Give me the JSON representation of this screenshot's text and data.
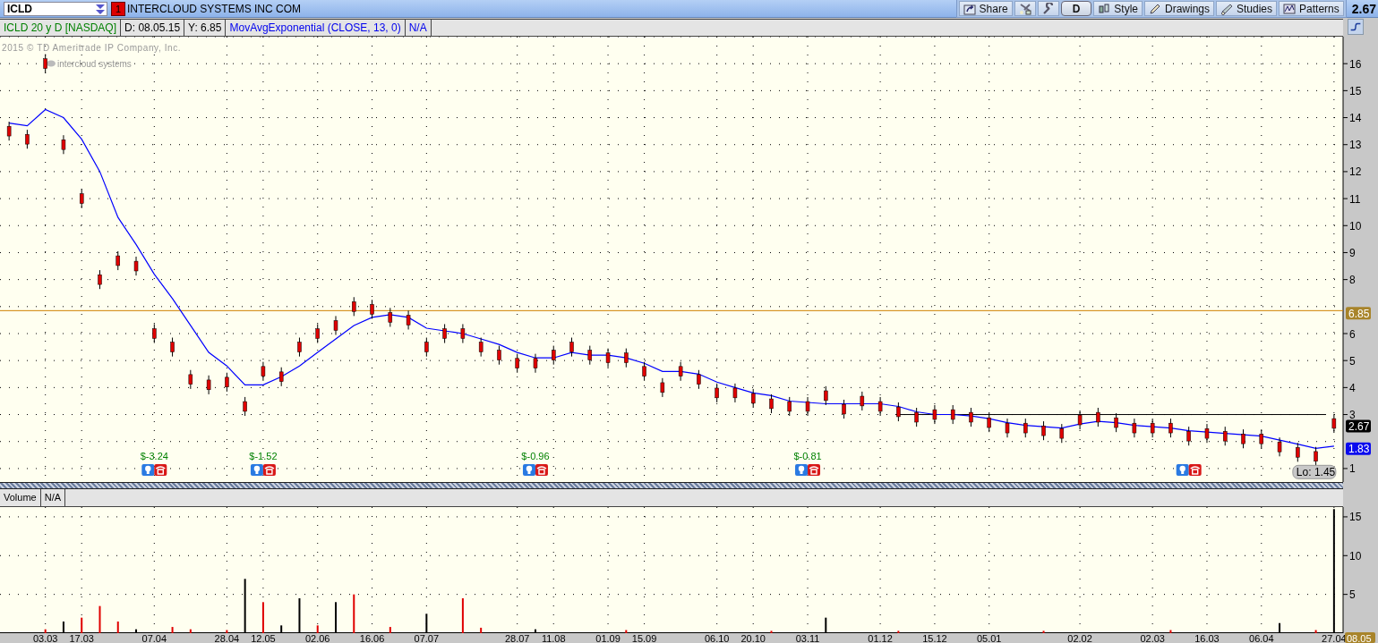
{
  "toolbar": {
    "symbol": "ICLD",
    "alert_badge": "1",
    "company": "INTERCLOUD SYSTEMS INC COM",
    "buttons": [
      {
        "label": "Share",
        "kind": "share"
      },
      {
        "kind": "tools"
      },
      {
        "kind": "wrench"
      },
      {
        "label": "D",
        "kind": "aggregation"
      },
      {
        "label": "Style",
        "kind": "style"
      },
      {
        "label": "Drawings",
        "kind": "drawings"
      },
      {
        "label": "Studies",
        "kind": "studies"
      },
      {
        "label": "Patterns",
        "kind": "patterns"
      }
    ],
    "last_price": "2.67"
  },
  "info_bar": [
    {
      "text": "ICLD 20 y D [NASDAQ]",
      "kind": "symbol"
    },
    {
      "text": "D: 08.05.15",
      "kind": "cursor"
    },
    {
      "text": "Y: 6.85",
      "kind": "cursor"
    },
    {
      "text": "MovAvgExponential (CLOSE, 13, 0)",
      "kind": "study"
    },
    {
      "text": "N/A",
      "kind": "study"
    }
  ],
  "price_pane": {
    "copyright": "2015 © TD Ameritrade IP Company, Inc.",
    "logo_text": "intercloud systems",
    "chart_data": {
      "type": "line",
      "grid": true,
      "ylim": [
        0.5,
        17
      ],
      "yticks": [
        1,
        3,
        4,
        5,
        6,
        8,
        9,
        10,
        11,
        12,
        13,
        14,
        15,
        16
      ],
      "series": [
        {
          "color": "#0000ff",
          "values": [
            13.8,
            13.7,
            14.3,
            14.0,
            13.2,
            12.0,
            10.3,
            9.3,
            8.2,
            7.3,
            6.3,
            5.3,
            4.8,
            4.1,
            4.1,
            4.4,
            4.8,
            5.3,
            5.8,
            6.3,
            6.6,
            6.7,
            6.6,
            6.2,
            6.1,
            6.0,
            5.8,
            5.6,
            5.3,
            5.1,
            5.1,
            5.3,
            5.2,
            5.2,
            5.1,
            4.9,
            4.6,
            4.6,
            4.5,
            4.2,
            4.0,
            3.8,
            3.7,
            3.5,
            3.45,
            3.4,
            3.4,
            3.4,
            3.4,
            3.3,
            3.1,
            3.0,
            3.0,
            2.95,
            2.85,
            2.7,
            2.6,
            2.55,
            2.5,
            2.65,
            2.75,
            2.7,
            2.6,
            2.55,
            2.5,
            2.4,
            2.35,
            2.3,
            2.25,
            2.2,
            2.05,
            1.9,
            1.75,
            1.83
          ]
        },
        {
          "type": "scatter",
          "color": "#e00000",
          "marker": "square",
          "values": [
            13.5,
            13.2,
            16.0,
            13.0,
            11.0,
            8.0,
            8.7,
            8.5,
            6.0,
            5.5,
            4.3,
            4.1,
            4.2,
            3.3,
            4.6,
            4.4,
            5.5,
            6.0,
            6.3,
            7.0,
            6.9,
            6.6,
            6.5,
            5.5,
            6.0,
            6.0,
            5.5,
            5.2,
            4.9,
            4.9,
            5.2,
            5.5,
            5.2,
            5.1,
            5.1,
            4.6,
            4.0,
            4.6,
            4.3,
            3.8,
            3.8,
            3.6,
            3.4,
            3.3,
            3.3,
            3.7,
            3.2,
            3.5,
            3.3,
            3.1,
            2.9,
            3.0,
            3.0,
            2.9,
            2.7,
            2.5,
            2.5,
            2.4,
            2.3,
            2.8,
            2.9,
            2.7,
            2.5,
            2.5,
            2.5,
            2.2,
            2.3,
            2.2,
            2.1,
            2.1,
            1.8,
            1.6,
            1.45,
            2.67
          ]
        }
      ],
      "ref_lines": [
        {
          "axis": "y",
          "value": 6.85,
          "color": "#d08000",
          "label": "6.85"
        },
        {
          "axis": "y",
          "value": 3,
          "color": "#000000"
        }
      ],
      "annotations": [
        "$-3.24",
        "$-1.52",
        "$-0.96",
        "$-0.81"
      ]
    },
    "price_badges": [
      {
        "text": "2.67",
        "kind": "last"
      },
      {
        "text": "1.83",
        "kind": "study"
      }
    ],
    "low_label": "Lo: 1.45"
  },
  "volume_pane": {
    "labels": [
      "Volume",
      "N/A"
    ],
    "chart_data": {
      "type": "bar",
      "grid": true,
      "ylim": [
        0,
        16.26
      ],
      "yticks": [
        5,
        10,
        15
      ],
      "categories": [
        null,
        null,
        "03.03",
        null,
        "17.03",
        null,
        null,
        null,
        "07.04",
        null,
        null,
        null,
        "28.04",
        null,
        "12.05",
        null,
        null,
        "02.06",
        null,
        null,
        "16.06",
        null,
        null,
        "07.07",
        null,
        null,
        null,
        null,
        "28.07",
        null,
        "11.08",
        null,
        null,
        "01.09",
        null,
        "15.09",
        null,
        null,
        null,
        "06.10",
        null,
        "20.10",
        null,
        null,
        "03.11",
        null,
        null,
        null,
        "01.12",
        null,
        null,
        "15.12",
        null,
        null,
        "05.01",
        null,
        null,
        null,
        null,
        "02.02",
        null,
        null,
        null,
        "02.03",
        null,
        null,
        "16.03",
        null,
        null,
        "06.04",
        null,
        null,
        null,
        "27.04"
      ],
      "series": [
        {
          "color": "#e00000",
          "values": [
            null,
            null,
            0.5,
            null,
            2,
            3.5,
            1.5,
            null,
            null,
            0.8,
            0.5,
            null,
            0.4,
            null,
            4,
            null,
            null,
            1,
            null,
            5,
            null,
            0.8,
            null,
            null,
            null,
            4.5,
            0.7,
            null,
            null,
            null,
            null,
            null,
            null,
            null,
            0.4,
            null,
            null,
            null,
            null,
            null,
            null,
            null,
            0.3,
            null,
            null,
            null,
            null,
            null,
            null,
            0.3,
            null,
            null,
            null,
            null,
            null,
            null,
            null,
            0.3,
            null,
            null,
            null,
            null,
            null,
            null,
            0.4,
            null,
            null,
            null,
            null,
            null,
            null,
            null,
            0.4,
            null
          ]
        },
        {
          "color": "#000000",
          "values": [
            null,
            null,
            null,
            1.5,
            null,
            null,
            null,
            0.5,
            null,
            null,
            null,
            null,
            null,
            7,
            null,
            1,
            4.5,
            null,
            4,
            null,
            null,
            null,
            null,
            2.5,
            null,
            null,
            null,
            null,
            null,
            0.5,
            null,
            null,
            null,
            null,
            null,
            null,
            null,
            null,
            null,
            null,
            null,
            null,
            null,
            null,
            null,
            2,
            null,
            null,
            null,
            null,
            null,
            null,
            null,
            null,
            null,
            null,
            null,
            null,
            null,
            null,
            null,
            null,
            null,
            null,
            null,
            null,
            null,
            null,
            null,
            null,
            1.3,
            null,
            null,
            16
          ]
        }
      ]
    },
    "date_badge": "08.05"
  }
}
